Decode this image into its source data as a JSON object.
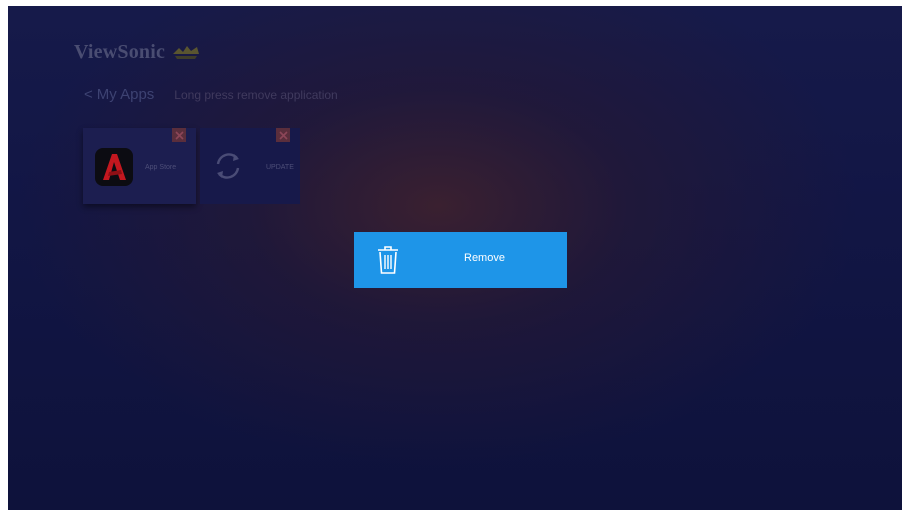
{
  "brand": {
    "name": "ViewSonic",
    "logo_icon": "birds-logo-icon"
  },
  "header": {
    "back_symbol": "<",
    "title": "My Apps",
    "hint": "Long press remove application"
  },
  "apps": [
    {
      "label": "App Store",
      "icon": "app-store-icon",
      "badge_icon": "remove-badge-icon"
    },
    {
      "label": "UPDATE",
      "icon": "sync-icon",
      "badge_icon": "remove-badge-icon"
    }
  ],
  "dialog": {
    "icon": "trash-icon",
    "label": "Remove",
    "color": "#1e95e8"
  },
  "colors": {
    "background": "#131747",
    "accent": "#1e95e8"
  }
}
